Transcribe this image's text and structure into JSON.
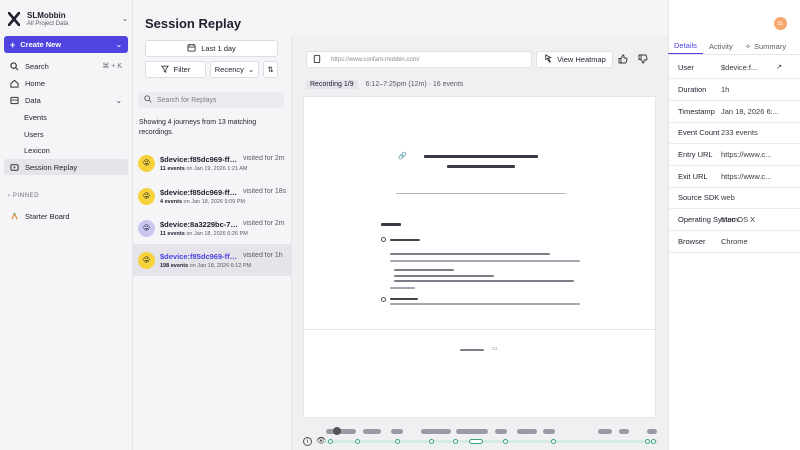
{
  "org": {
    "name": "SLMobbin",
    "subtitle": "All Project Data"
  },
  "sidebar": {
    "create_label": "Create New",
    "search_label": "Search",
    "search_shortcut": "⌘ + K",
    "home_label": "Home",
    "data_label": "Data",
    "events_label": "Events",
    "users_label": "Users",
    "lexicon_label": "Lexicon",
    "session_replay_label": "Session Replay",
    "pinned_heading": "PINNED",
    "starter_board_label": "Starter Board"
  },
  "page": {
    "title": "Session Replay"
  },
  "filters": {
    "date_range": "Last 1 day",
    "filter_label": "Filter",
    "sort_label": "Recency",
    "search_placeholder": "Search for Replays",
    "showing_text": "Showing 4 journeys from 13 matching recordings."
  },
  "recordings": [
    {
      "id": "$device:f85dc969-ffd...",
      "visit": "visited for 2m",
      "events": "11 events",
      "date": "on Jan 19, 2026 1:21 AM",
      "avatar_color": "#f6d33b"
    },
    {
      "id": "$device:f85dc969-ffd...",
      "visit": "visited for 18s",
      "events": "4 events",
      "date": "on Jan 18, 2026 9:09 PM",
      "avatar_color": "#f6d33b"
    },
    {
      "id": "$device:8a3229bc-70...",
      "visit": "visited for 2m",
      "events": "11 events",
      "date": "on Jan 18, 2026 6:26 PM",
      "avatar_color": "#c9c6f2"
    },
    {
      "id": "$device:f85dc969-ffdf...",
      "visit": "visited for 1h",
      "events": "198 events",
      "date": "on Jan 18, 2026 6:12 PM",
      "avatar_color": "#f6d33b"
    }
  ],
  "player": {
    "url": "https://www.confant-mobbin.com/",
    "heatmap_label": "View Heatmap",
    "recording_label": "Recording 1/9",
    "time_range": "6:12–7:25pm (12m) · 16 events"
  },
  "user_avatar_initials": "SL",
  "details": {
    "tabs": [
      "Details",
      "Activity",
      "Summary"
    ],
    "rows": [
      {
        "key": "User",
        "value": "$device:f..."
      },
      {
        "key": "Duration",
        "value": "1h"
      },
      {
        "key": "Timestamp",
        "value": "Jan 18, 2026 6:..."
      },
      {
        "key": "Event Count",
        "value": "233 events"
      },
      {
        "key": "Entry URL",
        "value": "https://www.c..."
      },
      {
        "key": "Exit URL",
        "value": "https://www.c..."
      },
      {
        "key": "Source SDK",
        "value": "web"
      },
      {
        "key": "Operating System",
        "value": "Mac OS X"
      },
      {
        "key": "Browser",
        "value": "Chrome"
      }
    ]
  },
  "colors": {
    "accent": "#4f44e0",
    "timeline_green": "#3aa37a"
  }
}
